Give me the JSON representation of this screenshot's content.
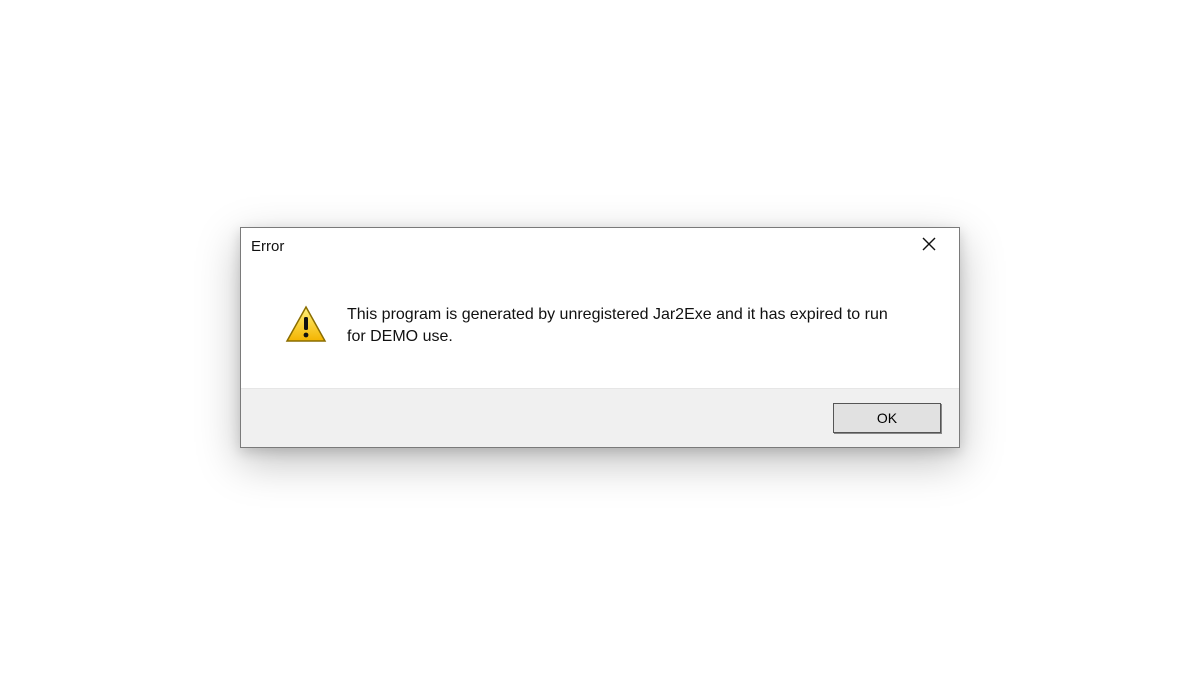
{
  "dialog": {
    "title": "Error",
    "message": "This program is generated by unregistered Jar2Exe and it has expired to run for DEMO use.",
    "ok_label": "OK"
  }
}
